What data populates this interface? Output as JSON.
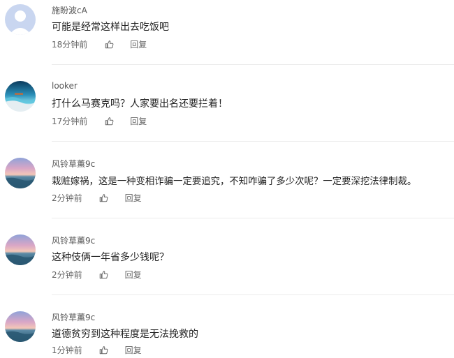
{
  "comments": [
    {
      "username": "施盼波cA",
      "text": "可能是经常这样出去吃饭吧",
      "time": "18分钟前",
      "reply_label": "回复",
      "avatar": "default-gray-avatar",
      "like_icon": "thumbs-up-icon"
    },
    {
      "username": "looker",
      "text": "打什么马赛克吗？人家要出名还要拦着！",
      "time": "17分钟前",
      "reply_label": "回复",
      "avatar": "ocean-photo-avatar",
      "like_icon": "thumbs-up-icon"
    },
    {
      "username": "风铃草薰9c",
      "text": "栽赃嫁祸，这是一种变相诈骗一定要追究，不知咋骗了多少次呢？一定要深挖法律制裁。",
      "time": "2分钟前",
      "reply_label": "回复",
      "avatar": "sunset-sea-avatar",
      "like_icon": "thumbs-up-icon"
    },
    {
      "username": "风铃草薰9c",
      "text": "这种伎俩一年省多少钱呢？",
      "time": "2分钟前",
      "reply_label": "回复",
      "avatar": "sunset-sea-avatar",
      "like_icon": "thumbs-up-icon"
    },
    {
      "username": "风铃草薰9c",
      "text": "道德贫穷到这种程度是无法挽救的",
      "time": "1分钟前",
      "reply_label": "回复",
      "avatar": "sunset-sea-avatar",
      "like_icon": "thumbs-up-icon"
    }
  ],
  "colors": {
    "text_primary": "#222222",
    "text_secondary": "#666666",
    "divider": "#ececec",
    "default_avatar_bg": "#c9d6f0"
  }
}
